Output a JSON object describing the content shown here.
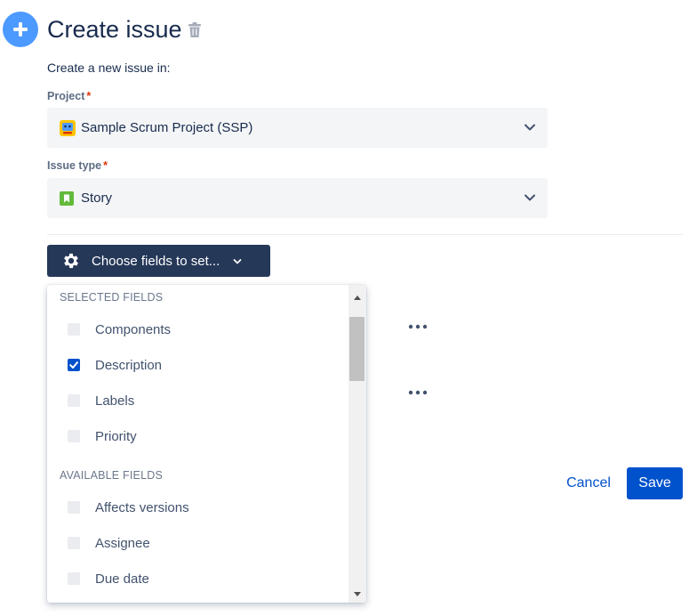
{
  "header": {
    "title": "Create issue",
    "icon": "plus-icon",
    "accent": "#4C9AFF"
  },
  "form": {
    "subtitle": "Create a new issue in:",
    "project": {
      "label": "Project",
      "required_marker": "*",
      "value": "Sample Scrum Project (SSP)",
      "icon": "project-avatar-icon"
    },
    "issue_type": {
      "label": "Issue type",
      "required_marker": "*",
      "value": "Story",
      "icon": "story-icon",
      "icon_color": "#63BA3C"
    }
  },
  "choose_fields": {
    "label": "Choose fields to set...",
    "icon": "gear-icon"
  },
  "dropdown": {
    "selected_heading": "SELECTED FIELDS",
    "selected": [
      {
        "label": "Components",
        "checked": false
      },
      {
        "label": "Description",
        "checked": true
      },
      {
        "label": "Labels",
        "checked": false
      },
      {
        "label": "Priority",
        "checked": false
      }
    ],
    "available_heading": "AVAILABLE FIELDS",
    "available": [
      {
        "label": "Affects versions",
        "checked": false
      },
      {
        "label": "Assignee",
        "checked": false
      },
      {
        "label": "Due date",
        "checked": false
      }
    ]
  },
  "actions": {
    "cancel": "Cancel",
    "save": "Save",
    "save_color": "#0052CC"
  }
}
